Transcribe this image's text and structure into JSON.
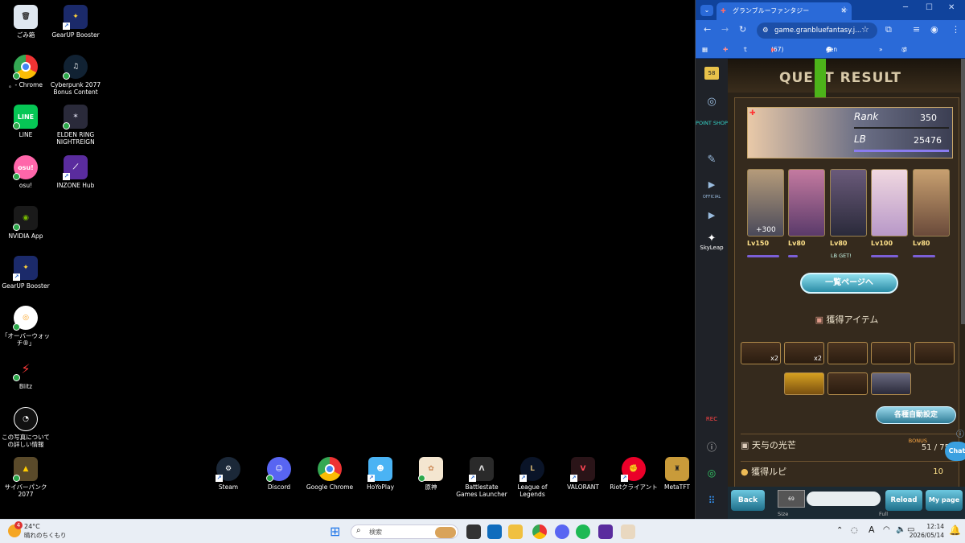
{
  "desktop": {
    "icons": [
      {
        "label": "ごみ箱"
      },
      {
        "label": "GearUP Booster"
      },
      {
        "label": "。- Chrome"
      },
      {
        "label": "Cyberpunk 2077 Bonus Content"
      },
      {
        "label": "LINE"
      },
      {
        "label": "ELDEN RING NIGHTREIGN"
      },
      {
        "label": "osu!"
      },
      {
        "label": "INZONE Hub"
      },
      {
        "label": "NVIDIA App"
      },
      {
        "label": "GearUP Booster"
      },
      {
        "label": "「オーバーウォッチ®」"
      },
      {
        "label": "Blitz"
      },
      {
        "label": "この写真についての詳しい情報"
      },
      {
        "label": "サイバーパンク2077"
      }
    ],
    "dock": [
      {
        "label": "Steam"
      },
      {
        "label": "Discord"
      },
      {
        "label": "Google Chrome"
      },
      {
        "label": "HoYoPlay"
      },
      {
        "label": "原神"
      },
      {
        "label": "Battlestate Games Launcher"
      },
      {
        "label": "League of Legends"
      },
      {
        "label": "VALORANT"
      },
      {
        "label": "Riotクライアント"
      },
      {
        "label": "MetaTFT"
      }
    ]
  },
  "browser": {
    "tab_title": "グランブルーファンタジー",
    "url": "game.granbluefantasy.j...",
    "bookmarks": [
      "ｔｙ",
      "(67) YouTube",
      "gen",
      "すべてのブックマーク"
    ],
    "sidebar": {
      "badge": "58",
      "point_shop": "POINT SHOP",
      "skyleap": "SkyLeap",
      "official": "OFFICIAL",
      "rec": "REC"
    }
  },
  "game": {
    "title": "QUEST RESULT",
    "rank_label": "Rank",
    "rank_value": "350",
    "lb_label": "LB",
    "lb_value": "25476",
    "party": [
      {
        "level": "Lv150",
        "extra": "+300"
      },
      {
        "level": "Lv80"
      },
      {
        "level": "Lv80",
        "extra": "LB GET!"
      },
      {
        "level": "Lv100"
      },
      {
        "level": "Lv80"
      }
    ],
    "list_button": "一覧ページへ",
    "items_header": "獲得アイテム",
    "item_counts": [
      "x2",
      "x2"
    ],
    "auto_settings": "各種自動設定",
    "reward1_name": "天与の光芒",
    "reward1_bonus": "BONUS",
    "reward1_value": "51 / 75",
    "reward2_name": "獲得ルピ",
    "reward2_value": "10",
    "chat": "Chat",
    "back": "Back",
    "reload": "Reload",
    "mypage": "My page",
    "size_label": "Size",
    "full_label": "Full",
    "party_badge": "69"
  },
  "taskbar": {
    "weather_temp": "24°C",
    "weather_desc": "晴れのちくもり",
    "weather_badge": "4",
    "search_placeholder": "検索",
    "time": "12:14",
    "date": "2026/05/14",
    "ime": "A"
  },
  "colors": {
    "taskbar": "#e9eef5",
    "chrome_blue": "#2a6ad8",
    "game_gold": "#ffe28a"
  }
}
